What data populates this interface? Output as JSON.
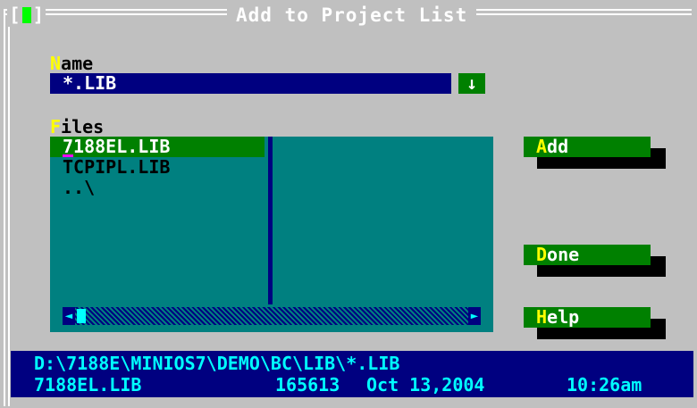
{
  "window": {
    "title": "Add to Project List",
    "close_symbol": "[ ]"
  },
  "name_field": {
    "label_hotkey": "N",
    "label_rest": "ame",
    "value": "*.LIB",
    "history_icon": "down-arrow-icon",
    "history_glyph": "↓"
  },
  "files": {
    "label_hotkey": "F",
    "label_rest": "iles",
    "items": [
      {
        "label": "7188EL.LIB",
        "selected": true
      },
      {
        "label": "TCPIPL.LIB",
        "selected": false
      },
      {
        "label": "..\\",
        "selected": false
      }
    ]
  },
  "buttons": {
    "add": {
      "hotkey": "A",
      "rest": "dd"
    },
    "done": {
      "hotkey": "D",
      "rest": "one"
    },
    "help": {
      "hotkey": "H",
      "rest": "elp"
    }
  },
  "status": {
    "path": "D:\\7188E\\MINIOS7\\DEMO\\BC\\LIB\\*.LIB",
    "file_name": "7188EL.LIB",
    "file_size": "165613",
    "file_date": "Oct 13,2004",
    "file_time": "10:26am"
  },
  "colors": {
    "dialog_bg": "#c0c0c0",
    "field_bg": "#000080",
    "list_bg": "#008080",
    "button_bg": "#008000",
    "hotkey": "#ffff00"
  }
}
